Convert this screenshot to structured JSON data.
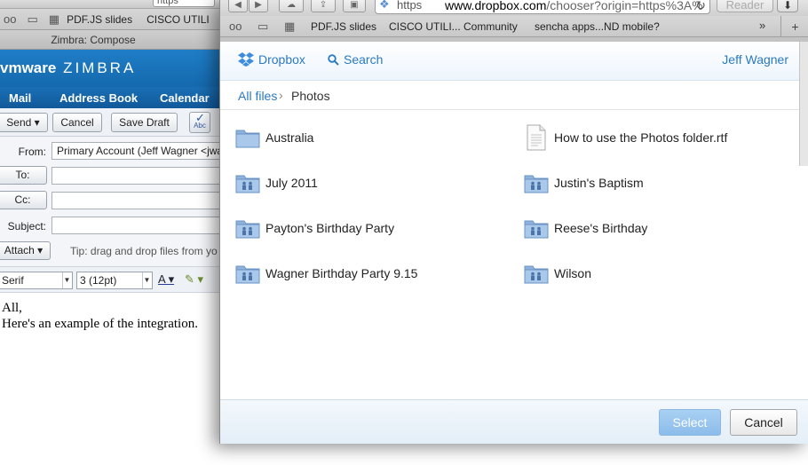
{
  "background": {
    "bookmarks": [
      "PDF.JS slides",
      "CISCO UTILI"
    ],
    "url_fragment": "https",
    "tab_title": "Zimbra: Compose",
    "logo_brand": "vmware",
    "logo_product": "ZIMBRA",
    "nav": [
      "Mail",
      "Address Book",
      "Calendar"
    ],
    "actions": {
      "send": "Send",
      "cancel": "Cancel",
      "save_draft": "Save Draft",
      "spell": "Abc"
    },
    "form": {
      "from_label": "From:",
      "from_value": "Primary Account (Jeff Wagner <jwa",
      "to_label": "To:",
      "cc_label": "Cc:",
      "subject_label": "Subject:",
      "attach_label": "Attach",
      "tip": "Tip: drag and drop files from yo"
    },
    "format": {
      "font": "Serif",
      "size": "3 (12pt)"
    },
    "body_lines": [
      "All,",
      "Here's an example of the integration."
    ]
  },
  "popup": {
    "url": {
      "scheme": "https",
      "host": "www.dropbox.com",
      "path": "/chooser?origin=https%3A%"
    },
    "reader": "Reader",
    "bookmarks": [
      "PDF.JS slides",
      "CISCO UTILI... Community",
      "sencha apps...ND mobile?"
    ],
    "more": "»",
    "dropbox": {
      "brand": "Dropbox",
      "search": "Search",
      "user": "Jeff Wagner",
      "breadcrumb": {
        "root": "All files",
        "sep": "›",
        "current": "Photos"
      },
      "items": [
        {
          "name": "Australia",
          "kind": "folder"
        },
        {
          "name": "How to use the Photos folder.rtf",
          "kind": "file"
        },
        {
          "name": "July 2011",
          "kind": "shared-folder"
        },
        {
          "name": "Justin's Baptism",
          "kind": "shared-folder"
        },
        {
          "name": "Payton's Birthday Party",
          "kind": "shared-folder"
        },
        {
          "name": "Reese's Birthday",
          "kind": "shared-folder"
        },
        {
          "name": "Wagner Birthday Party 9.15",
          "kind": "shared-folder"
        },
        {
          "name": "Wilson",
          "kind": "shared-folder"
        }
      ],
      "select": "Select",
      "cancel": "Cancel"
    }
  },
  "colors": {
    "accent": "#2a7ac2",
    "zimbra_blue": "#1569ad",
    "select_btn": "#8cbcea"
  }
}
